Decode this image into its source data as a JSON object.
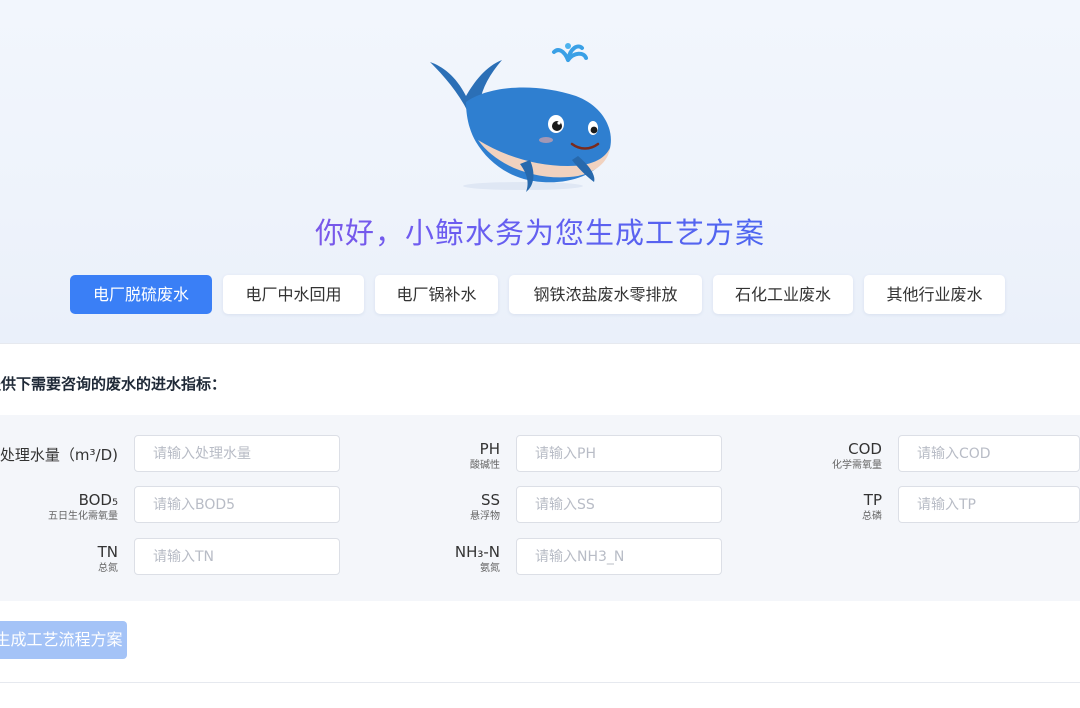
{
  "hero": {
    "mascot": "whale-mascot",
    "title": "你好，小鲸水务为您生成工艺方案"
  },
  "tabs": [
    {
      "label": "电厂脱硫废水",
      "active": true
    },
    {
      "label": "电厂中水回用",
      "active": false
    },
    {
      "label": "电厂锅补水",
      "active": false
    },
    {
      "label": "钢铁浓盐废水零排放",
      "active": false
    },
    {
      "label": "石化工业废水",
      "active": false
    },
    {
      "label": "其他行业废水",
      "active": false
    }
  ],
  "form": {
    "section_label": "提供下需要咨询的废水的进水指标：",
    "fields": {
      "flow": {
        "label": "处理水量（m³/D)",
        "sub": "",
        "placeholder": "请输入处理水量",
        "value": ""
      },
      "ph": {
        "label": "PH",
        "sub": "酸碱性",
        "placeholder": "请输入PH",
        "value": ""
      },
      "cod": {
        "label": "COD",
        "sub": "化学需氧量",
        "placeholder": "请输入COD",
        "value": ""
      },
      "bod5": {
        "label": "BOD₅",
        "sub": "五日生化需氧量",
        "placeholder": "请输入BOD5",
        "value": ""
      },
      "ss": {
        "label": "SS",
        "sub": "悬浮物",
        "placeholder": "请输入SS",
        "value": ""
      },
      "tp": {
        "label": "TP",
        "sub": "总磷",
        "placeholder": "请输入TP",
        "value": ""
      },
      "tn": {
        "label": "TN",
        "sub": "总氮",
        "placeholder": "请输入TN",
        "value": ""
      },
      "nh3n": {
        "label": "NH₃-N",
        "sub": "氨氮",
        "placeholder": "请输入NH3_N",
        "value": ""
      }
    },
    "submit_label": "生成工艺流程方案"
  },
  "colors": {
    "accent": "#3a7ff6",
    "submit_disabled": "#a4c3f7",
    "title_gradient_start": "#9b4ad6",
    "title_gradient_end": "#2f6ff0"
  }
}
